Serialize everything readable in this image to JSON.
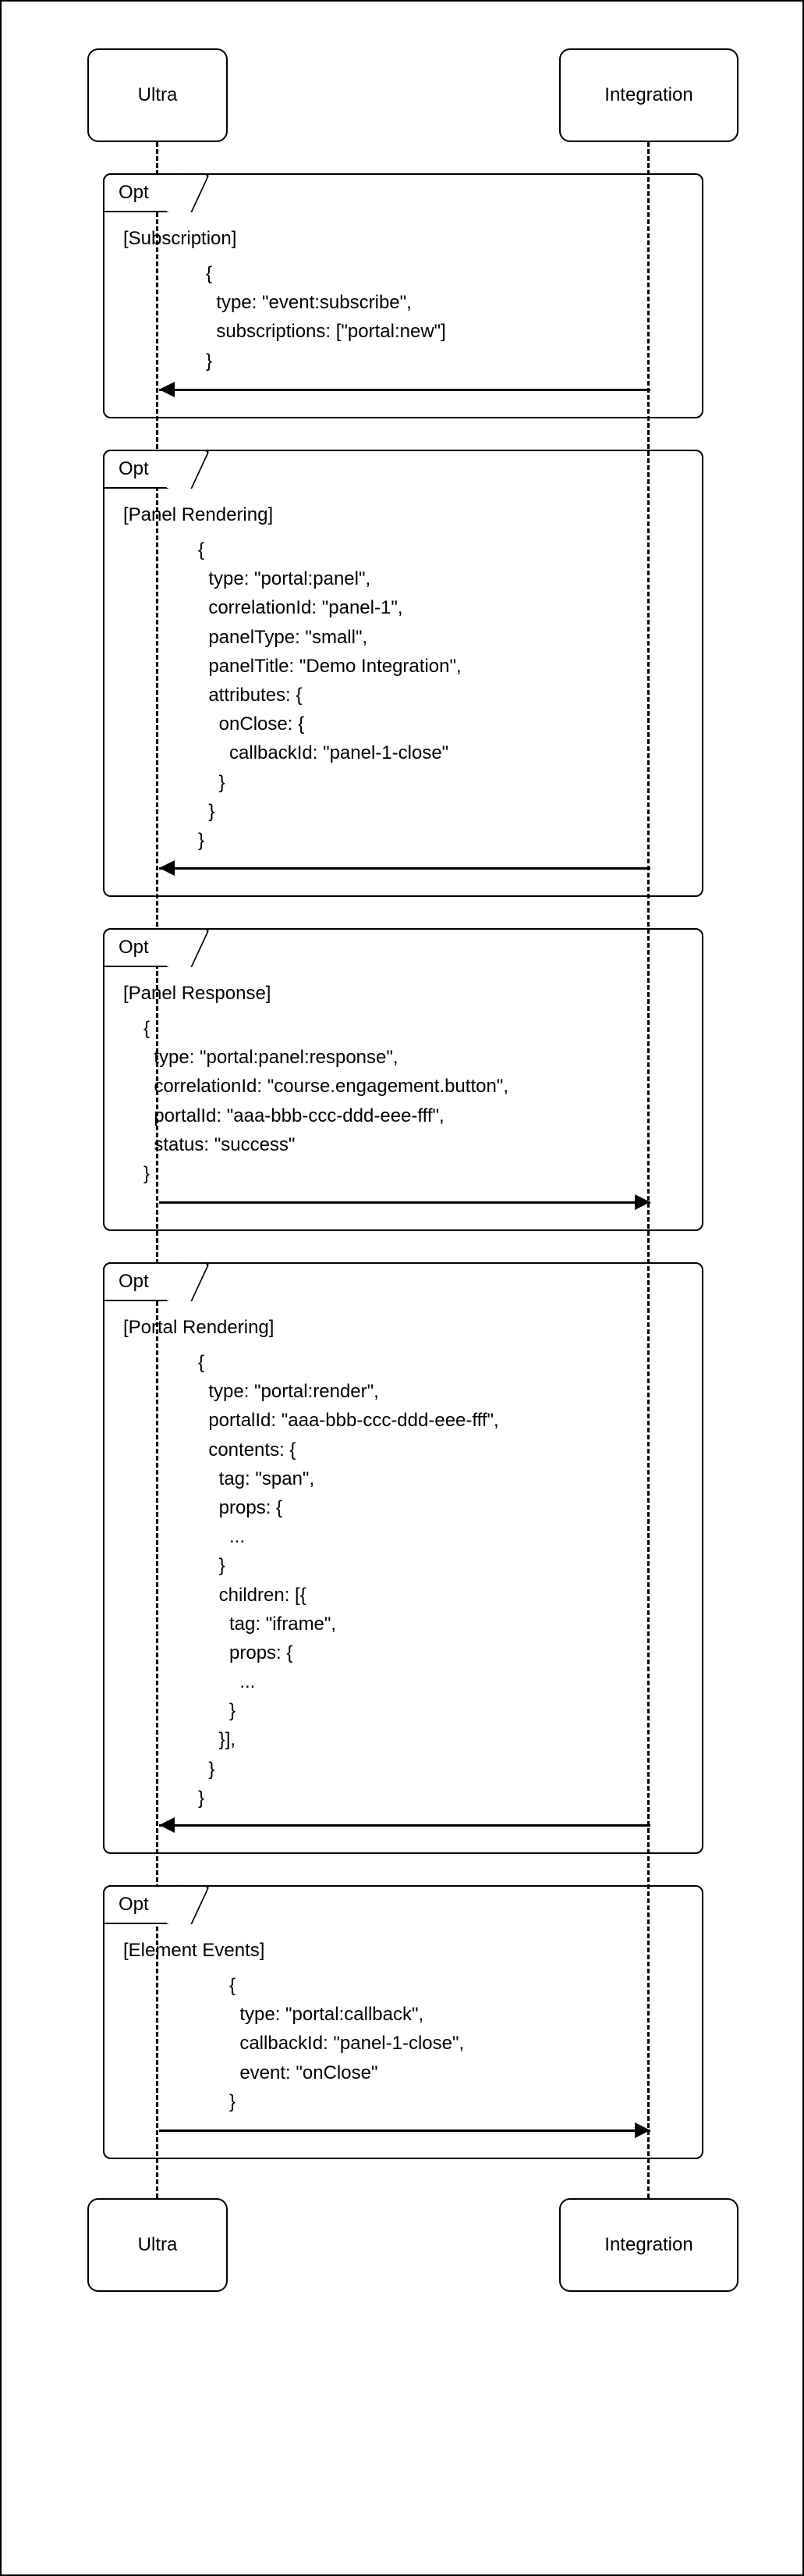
{
  "participants": {
    "ultra": "Ultra",
    "integration": "Integration"
  },
  "opt_label": "Opt",
  "fragments": [
    {
      "cond": "[Subscription]",
      "msg": "{\n  type: \"event:subscribe\",\n  subscriptions: [\"portal:new\"]\n}",
      "direction": "left"
    },
    {
      "cond": "[Panel Rendering]",
      "msg": "{\n  type: \"portal:panel\",\n  correlationId: \"panel-1\",\n  panelType: \"small\",\n  panelTitle: \"Demo Integration\",\n  attributes: {\n    onClose: {\n      callbackId: \"panel-1-close\"\n    }\n  }\n}",
      "direction": "left"
    },
    {
      "cond": "[Panel Response]",
      "msg": "{\n  type: \"portal:panel:response\",\n  correlationId: \"course.engagement.button\",\n  portalId: \"aaa-bbb-ccc-ddd-eee-fff\",\n  status: \"success\"\n}",
      "direction": "right"
    },
    {
      "cond": "[Portal Rendering]",
      "msg": "{\n  type: \"portal:render\",\n  portalId: \"aaa-bbb-ccc-ddd-eee-fff\",\n  contents: {\n    tag: \"span\",\n    props: {\n      ...\n    }\n    children: [{\n      tag: \"iframe\",\n      props: {\n        ...\n      }\n    }],\n  }\n}",
      "direction": "left"
    },
    {
      "cond": "[Element Events]",
      "msg": "{\n  type: \"portal:callback\",\n  callbackId: \"panel-1-close\",\n  event: \"onClose\"\n}",
      "direction": "right"
    }
  ],
  "layout": {
    "ultraX": 200,
    "integX": 830,
    "topY": 60,
    "pW_ultra": 180,
    "pW_integ": 230,
    "pH": 120,
    "gapAfterTop": 40,
    "optLeft": 130,
    "optWidth": 770,
    "optTabH": 50,
    "condGap": 18,
    "msgIndent": [
      260,
      250,
      180,
      250,
      290
    ],
    "msgGap": 10,
    "arrowGap": 18,
    "arrowH": 20,
    "optGap": 40,
    "lineH": 37
  }
}
